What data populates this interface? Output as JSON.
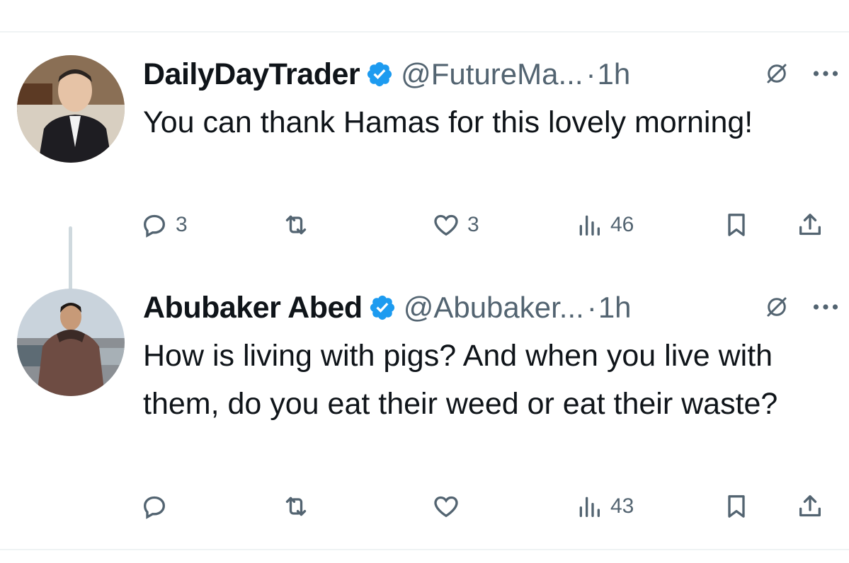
{
  "tweets": [
    {
      "display_name": "DailyDayTrader",
      "handle": "@FutureMa...",
      "separator": "·",
      "time": "1h",
      "text": "You can thank Hamas for this lovely morning!",
      "replies": "3",
      "reposts": "",
      "likes": "3",
      "views": "46",
      "avatar_icon": "profile-photo",
      "verified": true
    },
    {
      "display_name": "Abubaker Abed",
      "handle": "@Abubaker...",
      "separator": "·",
      "time": "1h",
      "text": "How is living with pigs? And when you live with them, do you eat their weed or eat their waste?",
      "replies": "",
      "reposts": "",
      "likes": "",
      "views": "43",
      "avatar_icon": "profile-photo",
      "verified": true
    }
  ],
  "colors": {
    "verified_blue": "#1d9bf0",
    "secondary_text": "#536471",
    "primary_text": "#0f1419",
    "thread_line": "#cfd9de"
  }
}
